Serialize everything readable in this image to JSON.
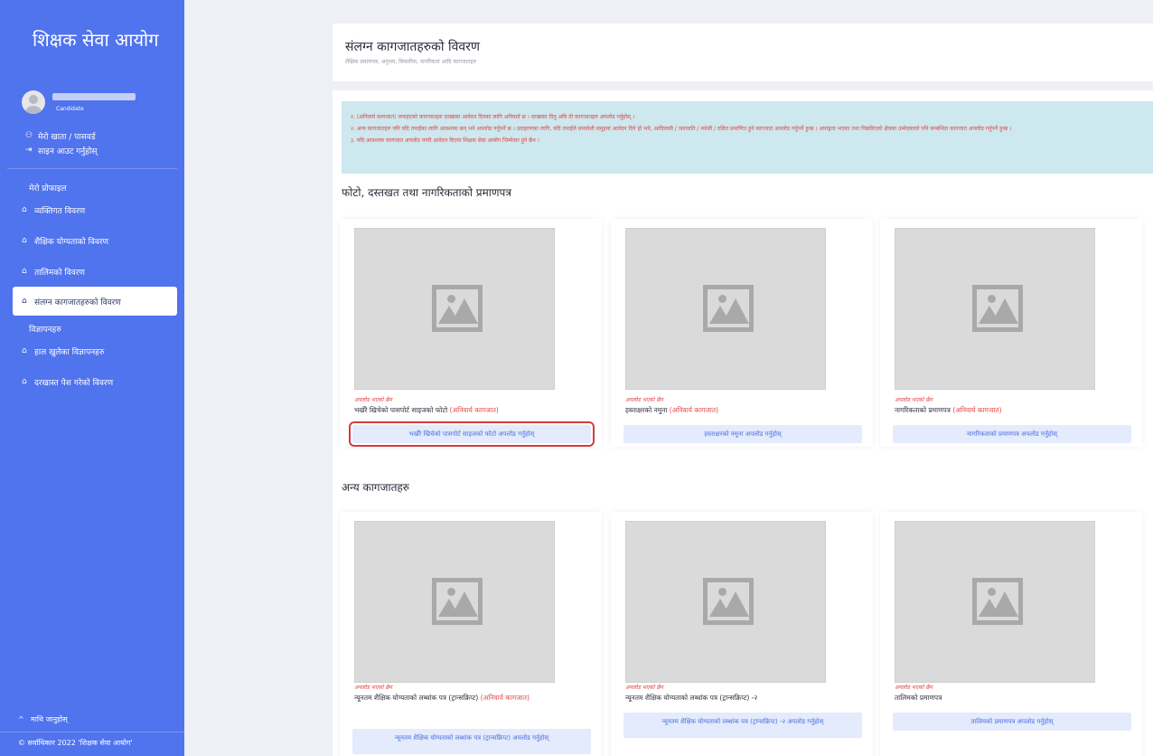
{
  "sidebar": {
    "brand": "शिक्षक सेवा आयोग",
    "user_role": "Candidate",
    "account_links": [
      {
        "icon": "user-icon",
        "glyph": "⚇",
        "label": "मेरो खाता / पासवर्ड"
      },
      {
        "icon": "logout-icon",
        "glyph": "⇥",
        "label": "साइन आउट गर्नुहोस्"
      }
    ],
    "group_profile": "मेरो प्रोफाइल",
    "group_ads": "विज्ञापनहरु",
    "items": [
      {
        "icon": "home-icon",
        "glyph": "⌂",
        "label": "व्यक्तिगत विवरण"
      },
      {
        "icon": "home-icon",
        "glyph": "⌂",
        "label": "शैक्षिक योग्यताको विवरण"
      },
      {
        "icon": "home-icon",
        "glyph": "⌂",
        "label": "तालिमको विवरण"
      },
      {
        "icon": "home-icon",
        "glyph": "⌂",
        "label": "संलग्न कागजातहरुको विवरण"
      },
      {
        "icon": "home-icon",
        "glyph": "⌂",
        "label": "हाल खुलेका विज्ञापनहरु"
      },
      {
        "icon": "home-icon",
        "glyph": "⌂",
        "label": "दरखास्त पेश गरेको विवरण"
      }
    ],
    "up_icon": "^",
    "up_label": "माथि जानुहोस्",
    "copyright": "© सर्वाधिकार 2022 'शिक्षक सेवा आयोग'"
  },
  "header": {
    "title": "संलग्न कागजातहरुको विवरण",
    "subtitle": "शैक्षिक प्रमाणपत्र, अनुभव, सिफारिस, नागरिकता आदि कागजातहरु"
  },
  "notice": {
    "lines": [
      "१. (अनिवार्य कागजात) जनाइएको कागजातहरु दरखास्त आवेदन दिनका लागि अनिवार्य छ । दरखास्त दिनु अघि ती कागजातहरु अपलोड गर्नुहोस् ।",
      "२. अन्य कागजातहरु पनि यदि तपाईंका लागि आवश्यक छन् भने अपलोड गर्नुपर्ने छ । उदाहरणका लागि, यदि तपाईंले समावेशी समूहमा आवेदन दिने हो भने, आदिवासी / जनजाति / मधेसी / दलित प्रमाणित हुने कागजात अपलोड गर्नुपर्ने हुन्छ । अपाङ्गता भएका तथा पिछडिएको क्षेत्रका उम्मेदवारले पनि सम्बन्धित कागजात अपलोड गर्नुपर्ने हुन्छ ।",
      "३. यदि आवश्यक कागजात अपलोड नगरी आवेदन दिएमा शिक्षक सेवा आयोग जिम्मेवार हुने छैन ।"
    ]
  },
  "sections": {
    "photos_title": "फोटो, दस्तखत तथा नागरिकताको प्रमाणपत्र",
    "other_title": "अन्य कागजातहरु"
  },
  "photo_docs": [
    {
      "status": "अपलोड भएको छैन",
      "name": "भर्खरै खिचेको पासपोर्ट साइजको फोटो",
      "required": "(अनिवार्य कागजात)",
      "button": "भर्खरै खिचेको पासपोर्ट साइजको फोटो अपलोड गर्नुहोस्"
    },
    {
      "status": "अपलोड भएको छैन",
      "name": "हस्ताक्षरको नमुना",
      "required": "(अनिवार्य कागजात)",
      "button": "हस्ताक्षरको नमुना अपलोड गर्नुहोस्"
    },
    {
      "status": "अपलोड भएको छैन",
      "name": "नागरिकताको प्रमाणपत्र",
      "required": "(अनिवार्य कागजात)",
      "button": "नागरिकताको प्रमाणपत्र अपलोड गर्नुहोस्"
    }
  ],
  "other_docs": [
    {
      "status": "अपलोड भएको छैन",
      "name": "न्यूनतम शैक्षिक योग्यताको लब्धांक पत्र (ट्रान्सक्रिप्ट)",
      "required": "(अनिवार्य कागजात)",
      "button": "न्यूनतम शैक्षिक योग्यताको लब्धांक पत्र (ट्रान्सक्रिप्ट) अपलोड गर्नुहोस्"
    },
    {
      "status": "अपलोड भएको छैन",
      "name": "न्यूनतम शैक्षिक योग्यताको लब्धांक पत्र (ट्रान्सक्रिप्ट) -२",
      "required": "",
      "button": "न्यूनतम शैक्षिक योग्यताको लब्धांक पत्र (ट्रान्सक्रिप्ट) -२ अपलोड गर्नुहोस्"
    },
    {
      "status": "अपलोड भएको छैन",
      "name": "तालिमको प्रमाणपत्र",
      "required": "",
      "button": "तालिमको प्रमाणपत्र अपलोड गर्नुहोस्"
    }
  ],
  "colors": {
    "sidebar": "#5073ee",
    "alert_bg": "#cde8ee",
    "alert_text": "#e14848",
    "button_bg": "#e3ebfd",
    "button_text": "#4d6fe0",
    "highlight": "#d63b3b"
  }
}
